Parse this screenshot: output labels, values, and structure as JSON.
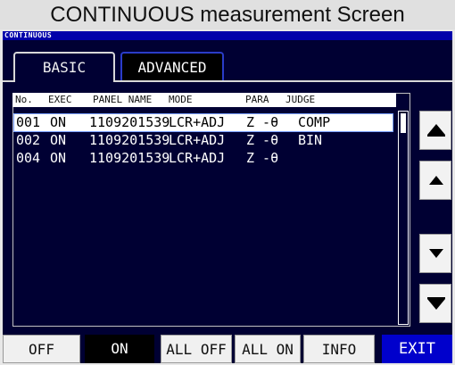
{
  "page_title": "CONTINUOUS measurement Screen",
  "mode_label": "CONTINUOUS",
  "tabs": [
    {
      "label": "BASIC",
      "active": true
    },
    {
      "label": "ADVANCED",
      "active": false
    }
  ],
  "list": {
    "headers": {
      "no": "No.",
      "exec": "EXEC",
      "panel_name": "PANEL NAME",
      "mode": "MODE",
      "para": "PARA",
      "judge": "JUDGE"
    },
    "rows": [
      {
        "no": "001",
        "exec": "ON",
        "panel_name": "1109201539",
        "mode": "LCR+ADJ",
        "para": "Z -θ",
        "judge": "COMP",
        "selected": true
      },
      {
        "no": "002",
        "exec": "ON",
        "panel_name": "1109201539",
        "mode": "LCR+ADJ",
        "para": "Z -θ",
        "judge": "BIN",
        "selected": false
      },
      {
        "no": "004",
        "exec": "ON",
        "panel_name": "1109201539",
        "mode": "LCR+ADJ",
        "para": "Z -θ",
        "judge": "",
        "selected": false
      }
    ]
  },
  "side_icons": [
    "page-up-icon",
    "scroll-up-icon",
    "scroll-down-icon",
    "page-down-icon"
  ],
  "bottom_buttons": {
    "off": "OFF",
    "on": "ON",
    "all_off": "ALL OFF",
    "all_on": "ALL ON",
    "info": "INFO",
    "exit": "EXIT"
  },
  "colors": {
    "screen_bg": "#000033",
    "mode_bar": "#0000aa",
    "exit_bg": "#0000cc",
    "tab_adv_border": "#2a3cc8"
  }
}
